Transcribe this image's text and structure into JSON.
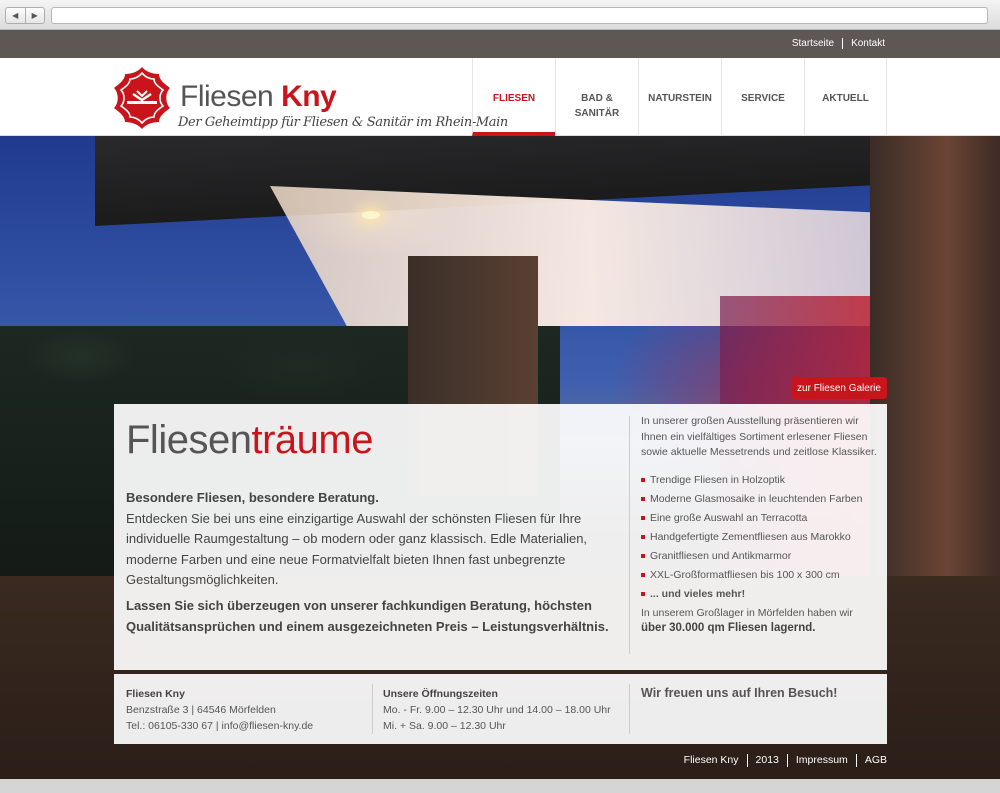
{
  "browser": {
    "back_icon": "back-arrow-icon",
    "forward_icon": "forward-arrow-icon",
    "back_glyph": "◀",
    "forward_glyph": "▶"
  },
  "top_links": [
    "Startseite",
    "Kontakt"
  ],
  "brand": {
    "name_regular": "Fliesen",
    "name_bold": "Kny",
    "tagline": "Der Geheimtipp für Fliesen & Sanitär im Rhein-Main",
    "accent_color": "#c8151b"
  },
  "nav": {
    "items": [
      {
        "label": "FLIESEN",
        "active": true
      },
      {
        "label": "BAD &",
        "label2": "SANITÄR"
      },
      {
        "label": "NATURSTEIN"
      },
      {
        "label": "SERVICE"
      },
      {
        "label": "AKTUELL"
      }
    ]
  },
  "hero": {
    "gallery_button": "zur Fliesen Galerie"
  },
  "main": {
    "headline_part1": "Fliesen",
    "headline_part2": "träume",
    "intro_bold": "Besondere Fliesen, besondere Beratung.",
    "intro_text": "Entdecken Sie bei uns eine einzigartige Auswahl der schönsten Fliesen für Ihre individuelle Raumgestaltung – ob modern oder ganz klassisch. Edle Materialien, moderne Farben und eine neue Formatvielfalt bieten Ihnen fast unbegrenzte Gestaltungsmöglichkeiten.",
    "claim": "Lassen Sie sich überzeugen von unserer fachkundigen Beratung, höchsten Qualitätsansprüchen und einem ausgezeichneten Preis – Leistungsverhältnis."
  },
  "side": {
    "intro": "In unserer großen Ausstellung präsentieren wir Ihnen ein vielfältiges Sortiment erlesener Fliesen sowie aktuelle Messetrends und zeitlose Klassiker.",
    "features": [
      "Trendige Fliesen in Holzoptik",
      "Moderne Glasmosaike in leuchtenden Farben",
      "Eine große Auswahl an Terracotta",
      "Handgefertigte Zementfliesen aus Marokko",
      "Granitfliesen und Antikmarmor",
      "XXL-Großformatfliesen bis 100 x 300 cm",
      "... und vieles mehr!"
    ],
    "lager_text": "In unserem Großlager in Mörfelden haben wir",
    "lager_bold": "über 30.000 qm Fliesen lagernd."
  },
  "footer": {
    "company": "Fliesen Kny",
    "address": "Benzstraße 3 | 64546 Mörfelden",
    "contact": "Tel.: 06105-330 67 | info@fliesen-kny.de",
    "hours_title": "Unsere Öffnungszeiten",
    "hours_1": "Mo. - Fr. 9.00 – 12.30 Uhr und 14.00 – 18.00 Uhr",
    "hours_2": "Mi. + Sa. 9.00 – 12.30 Uhr",
    "welcome": "Wir freuen uns auf Ihren Besuch!"
  },
  "bottom_links": [
    "Fliesen Kny",
    "2013",
    "Impressum",
    "AGB"
  ]
}
